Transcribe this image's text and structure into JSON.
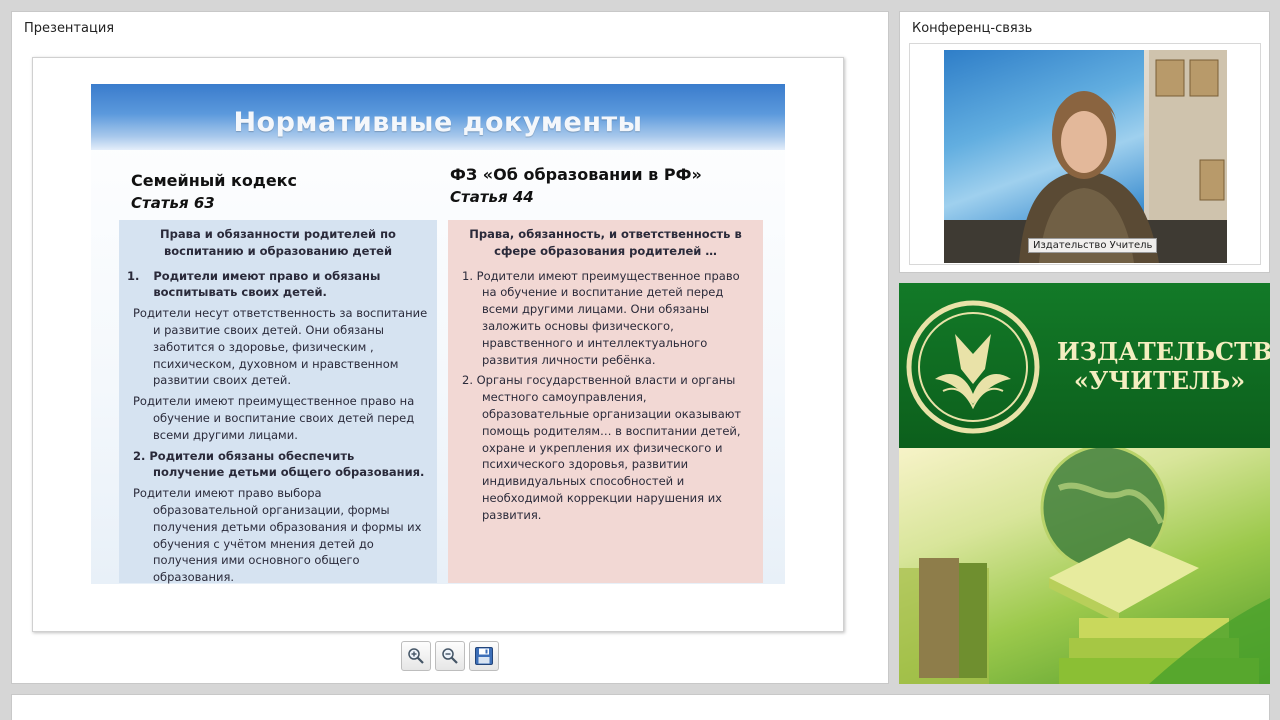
{
  "presentation": {
    "title": "Презентация",
    "slide": {
      "title": "Нормативные документы",
      "left": {
        "heading": "Семейный кодекс",
        "subheading": "Статья 63",
        "box_head": "Права и обязанности родителей по воспитанию и образованию детей",
        "item1_num": "1.",
        "item1": "Родители имеют право и обязаны воспитывать своих детей.",
        "p1": "Родители несут ответственность за воспитание и развитие своих детей. Они обязаны заботится о здоровье, физическим , психическом, духовном и нравственном развитии своих детей.",
        "p2": "Родители имеют преимущественное право на обучение и воспитание своих детей перед всеми другими лицами.",
        "item2": "2. Родители обязаны обеспечить получение детьми общего образования.",
        "p3": "Родители имеют право выбора образовательной организации, формы получения детьми образования и формы их обучения с учётом мнения детей до получения ими основного общего образования."
      },
      "right": {
        "heading": "ФЗ «Об образовании в РФ»",
        "subheading": "Статья 44",
        "box_head": "Права, обязанность, и ответственность в сфере образования родителей …",
        "item1": "1. Родители имеют преимущественное право на обучение и воспитание детей перед всеми другими лицами. Они обязаны заложить основы физического, нравственного и интеллектуального развития личности ребёнка.",
        "item2": "2. Органы государственной власти и органы местного самоуправления, образовательные организации оказывают помощь родителям… в воспитании детей, охране и укрепления их физического и психического здоровья, развитии индивидуальных способностей и необходимой коррекции нарушения их развития."
      }
    },
    "toolbar": {
      "zoom_in_icon": "zoom-in-icon",
      "zoom_out_icon": "zoom-out-icon",
      "save_icon": "save-icon"
    }
  },
  "conference": {
    "title": "Конференц-связь",
    "caption": "Издательство Учитель"
  },
  "publisher": {
    "name_line1": "ИЗДАТЕЛЬСТВО",
    "name_line2": "«УЧИТЕЛЬ»"
  },
  "colors": {
    "slide_header": "#3a7ccc",
    "left_box": "#d6e3f1",
    "right_box": "#f2d8d4",
    "publisher_green": "#137a28"
  }
}
